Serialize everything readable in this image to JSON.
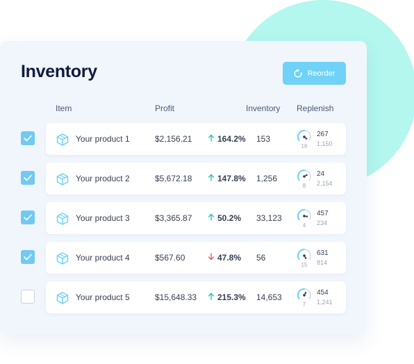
{
  "header": {
    "title": "Inventory",
    "reorder_label": "Reorder"
  },
  "columns": {
    "item": "Item",
    "profit": "Profit",
    "inventory": "Inventory",
    "replenish": "Replenish"
  },
  "colors": {
    "accent": "#6fd2f6",
    "positive": "#22c5b0",
    "negative": "#f0565d",
    "blob": "#b3f7ef"
  },
  "rows": [
    {
      "checked": true,
      "name": "Your product 1",
      "profit": "$2,156.21",
      "change": "164.2%",
      "trend": "up",
      "inventory": "153",
      "gauge": "16",
      "replenish_top": "267",
      "replenish_bottom": "1,150"
    },
    {
      "checked": true,
      "name": "Your product 2",
      "profit": "$5,672.18",
      "change": "147.8%",
      "trend": "up",
      "inventory": "1,256",
      "gauge": "8",
      "replenish_top": "24",
      "replenish_bottom": "2,154"
    },
    {
      "checked": true,
      "name": "Your product 3",
      "profit": "$3,365.87",
      "change": "50.2%",
      "trend": "up",
      "inventory": "33,123",
      "gauge": "4",
      "replenish_top": "457",
      "replenish_bottom": "234"
    },
    {
      "checked": true,
      "name": "Your product 4",
      "profit": "$567.60",
      "change": "47.8%",
      "trend": "down",
      "inventory": "56",
      "gauge": "15",
      "replenish_top": "631",
      "replenish_bottom": "814"
    },
    {
      "checked": false,
      "name": "Your product 5",
      "profit": "$15,648.33",
      "change": "215.3%",
      "trend": "up",
      "inventory": "14,653",
      "gauge": "7",
      "replenish_top": "454",
      "replenish_bottom": "1,241"
    }
  ]
}
